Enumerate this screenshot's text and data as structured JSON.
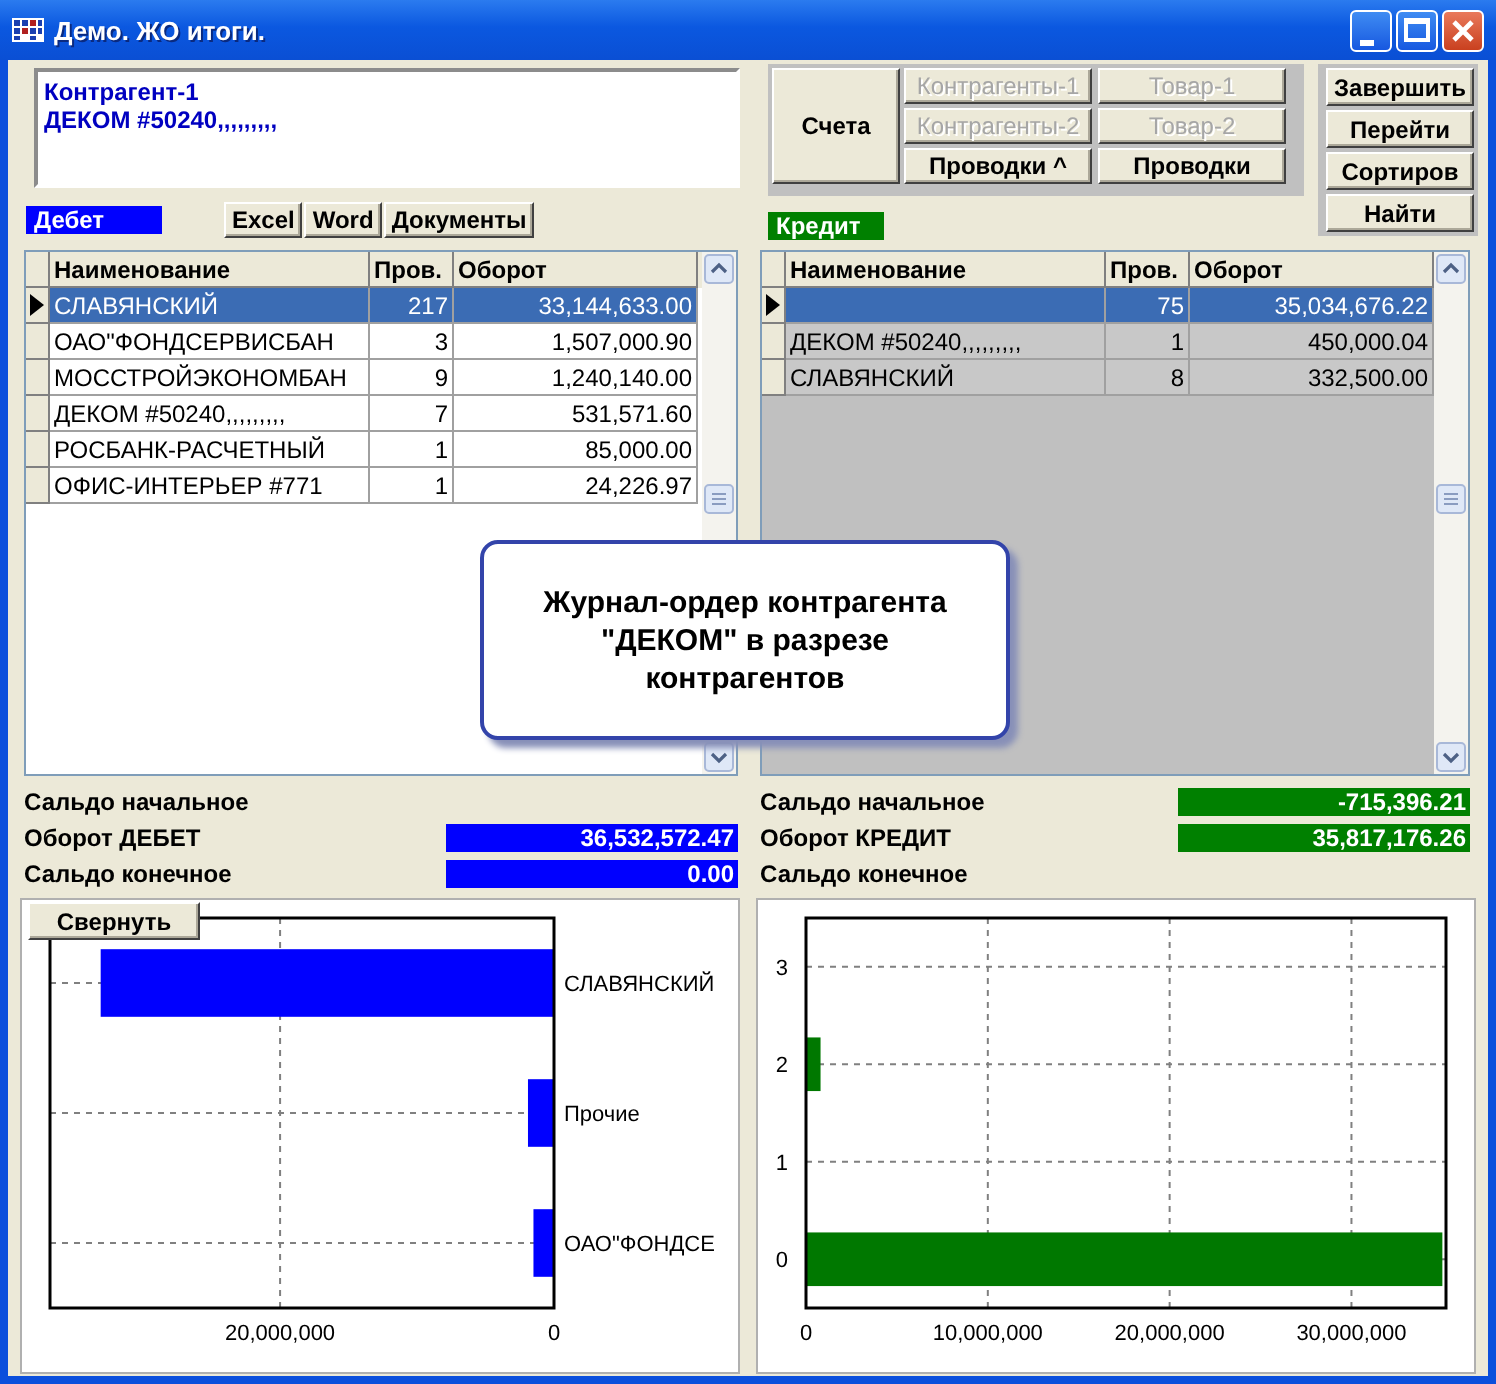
{
  "window": {
    "title": "Демо. ЖО итоги."
  },
  "info": {
    "lines": [
      "Контрагент-1",
      "ДЕКОМ #50240,,,,,,,,,"
    ]
  },
  "main_button": {
    "label": "Счета"
  },
  "nav_buttons": [
    {
      "label": "Контрагенты-1",
      "disabled": true
    },
    {
      "label": "Товар-1",
      "disabled": true
    },
    {
      "label": "Контрагенты-2",
      "disabled": true
    },
    {
      "label": "Товар-2",
      "disabled": true
    },
    {
      "label": "Проводки ^",
      "disabled": false
    },
    {
      "label": "Проводки",
      "disabled": false
    }
  ],
  "action_buttons": [
    "Завершить",
    "Перейти",
    "Сортиров",
    "Найти"
  ],
  "debit": {
    "label": "Дебет",
    "export_buttons": [
      "Excel",
      "Word",
      "Документы"
    ],
    "columns": [
      "Наименование",
      "Пров.",
      "Оборот"
    ],
    "rows": [
      {
        "name": "СЛАВЯНСКИЙ",
        "count": "217",
        "amount": "33,144,633.00",
        "selected": true
      },
      {
        "name": "ОАО\"ФОНДСЕРВИСБАН",
        "count": "3",
        "amount": "1,507,000.90",
        "selected": false
      },
      {
        "name": "МОССТРОЙЭКОНОМБАН",
        "count": "9",
        "amount": "1,240,140.00",
        "selected": false
      },
      {
        "name": "ДЕКОМ #50240,,,,,,,,,",
        "count": "7",
        "amount": "531,571.60",
        "selected": false
      },
      {
        "name": "РОСБАНК-РАСЧЕТНЫЙ",
        "count": "1",
        "amount": "85,000.00",
        "selected": false
      },
      {
        "name": "ОФИС-ИНТЕРЬЕР #771",
        "count": "1",
        "amount": "24,226.97",
        "selected": false
      }
    ],
    "summary": [
      {
        "label": "Сальдо начальное"
      },
      {
        "label": "Оборот ДЕБЕТ",
        "value": "36,532,572.47"
      },
      {
        "label": "Сальдо конечное",
        "value": "0.00"
      }
    ],
    "chart_data": {
      "type": "bar",
      "orientation": "horizontal",
      "categories": [
        "СЛАВЯНСКИЙ",
        "Прочие",
        "ОАО\"ФОНДСЕ"
      ],
      "series": [
        {
          "color": "#0000ff",
          "values": [
            33100000,
            1900000,
            1500000
          ]
        }
      ],
      "grid": true,
      "xlim": [
        36800000,
        0
      ],
      "xticks": [
        {
          "value": 20000000,
          "label": "20,000,000"
        },
        {
          "value": 0,
          "label": "0"
        }
      ]
    }
  },
  "credit": {
    "label": "Кредит",
    "columns": [
      "Наименование",
      "Пров.",
      "Оборот"
    ],
    "rows": [
      {
        "count": "75",
        "amount": "35,034,676.22",
        "selected": true
      },
      {
        "name": "ДЕКОМ #50240,,,,,,,,,",
        "count": "1",
        "amount": "450,000.04",
        "selected": false
      },
      {
        "name": "СЛАВЯНСКИЙ",
        "count": "8",
        "amount": "332,500.00",
        "selected": false
      }
    ],
    "summary": [
      {
        "label": "Сальдо начальное",
        "value": "-715,396.21"
      },
      {
        "label": "Оборот КРЕДИТ",
        "value": "35,817,176.26"
      },
      {
        "label": "Сальдо конечное"
      }
    ],
    "chart_data": {
      "type": "bar",
      "orientation": "horizontal",
      "categories": [
        "3",
        "2",
        "1",
        "0"
      ],
      "series": [
        {
          "color": "#007800",
          "values": [
            null,
            800000,
            null,
            35000000
          ]
        }
      ],
      "grid": true,
      "xlim": [
        0,
        35200000
      ],
      "xticks": [
        {
          "value": 0,
          "label": "0"
        },
        {
          "value": 10000000,
          "label": "10,000,000"
        },
        {
          "value": 20000000,
          "label": "20,000,000"
        },
        {
          "value": 30000000,
          "label": "30,000,000"
        }
      ]
    }
  },
  "callout": {
    "text": "Журнал-ордер контрагента\n\"ДЕКОМ\" в разрезе\nконтрагентов"
  },
  "collapse_button": {
    "label": "Свернуть"
  }
}
